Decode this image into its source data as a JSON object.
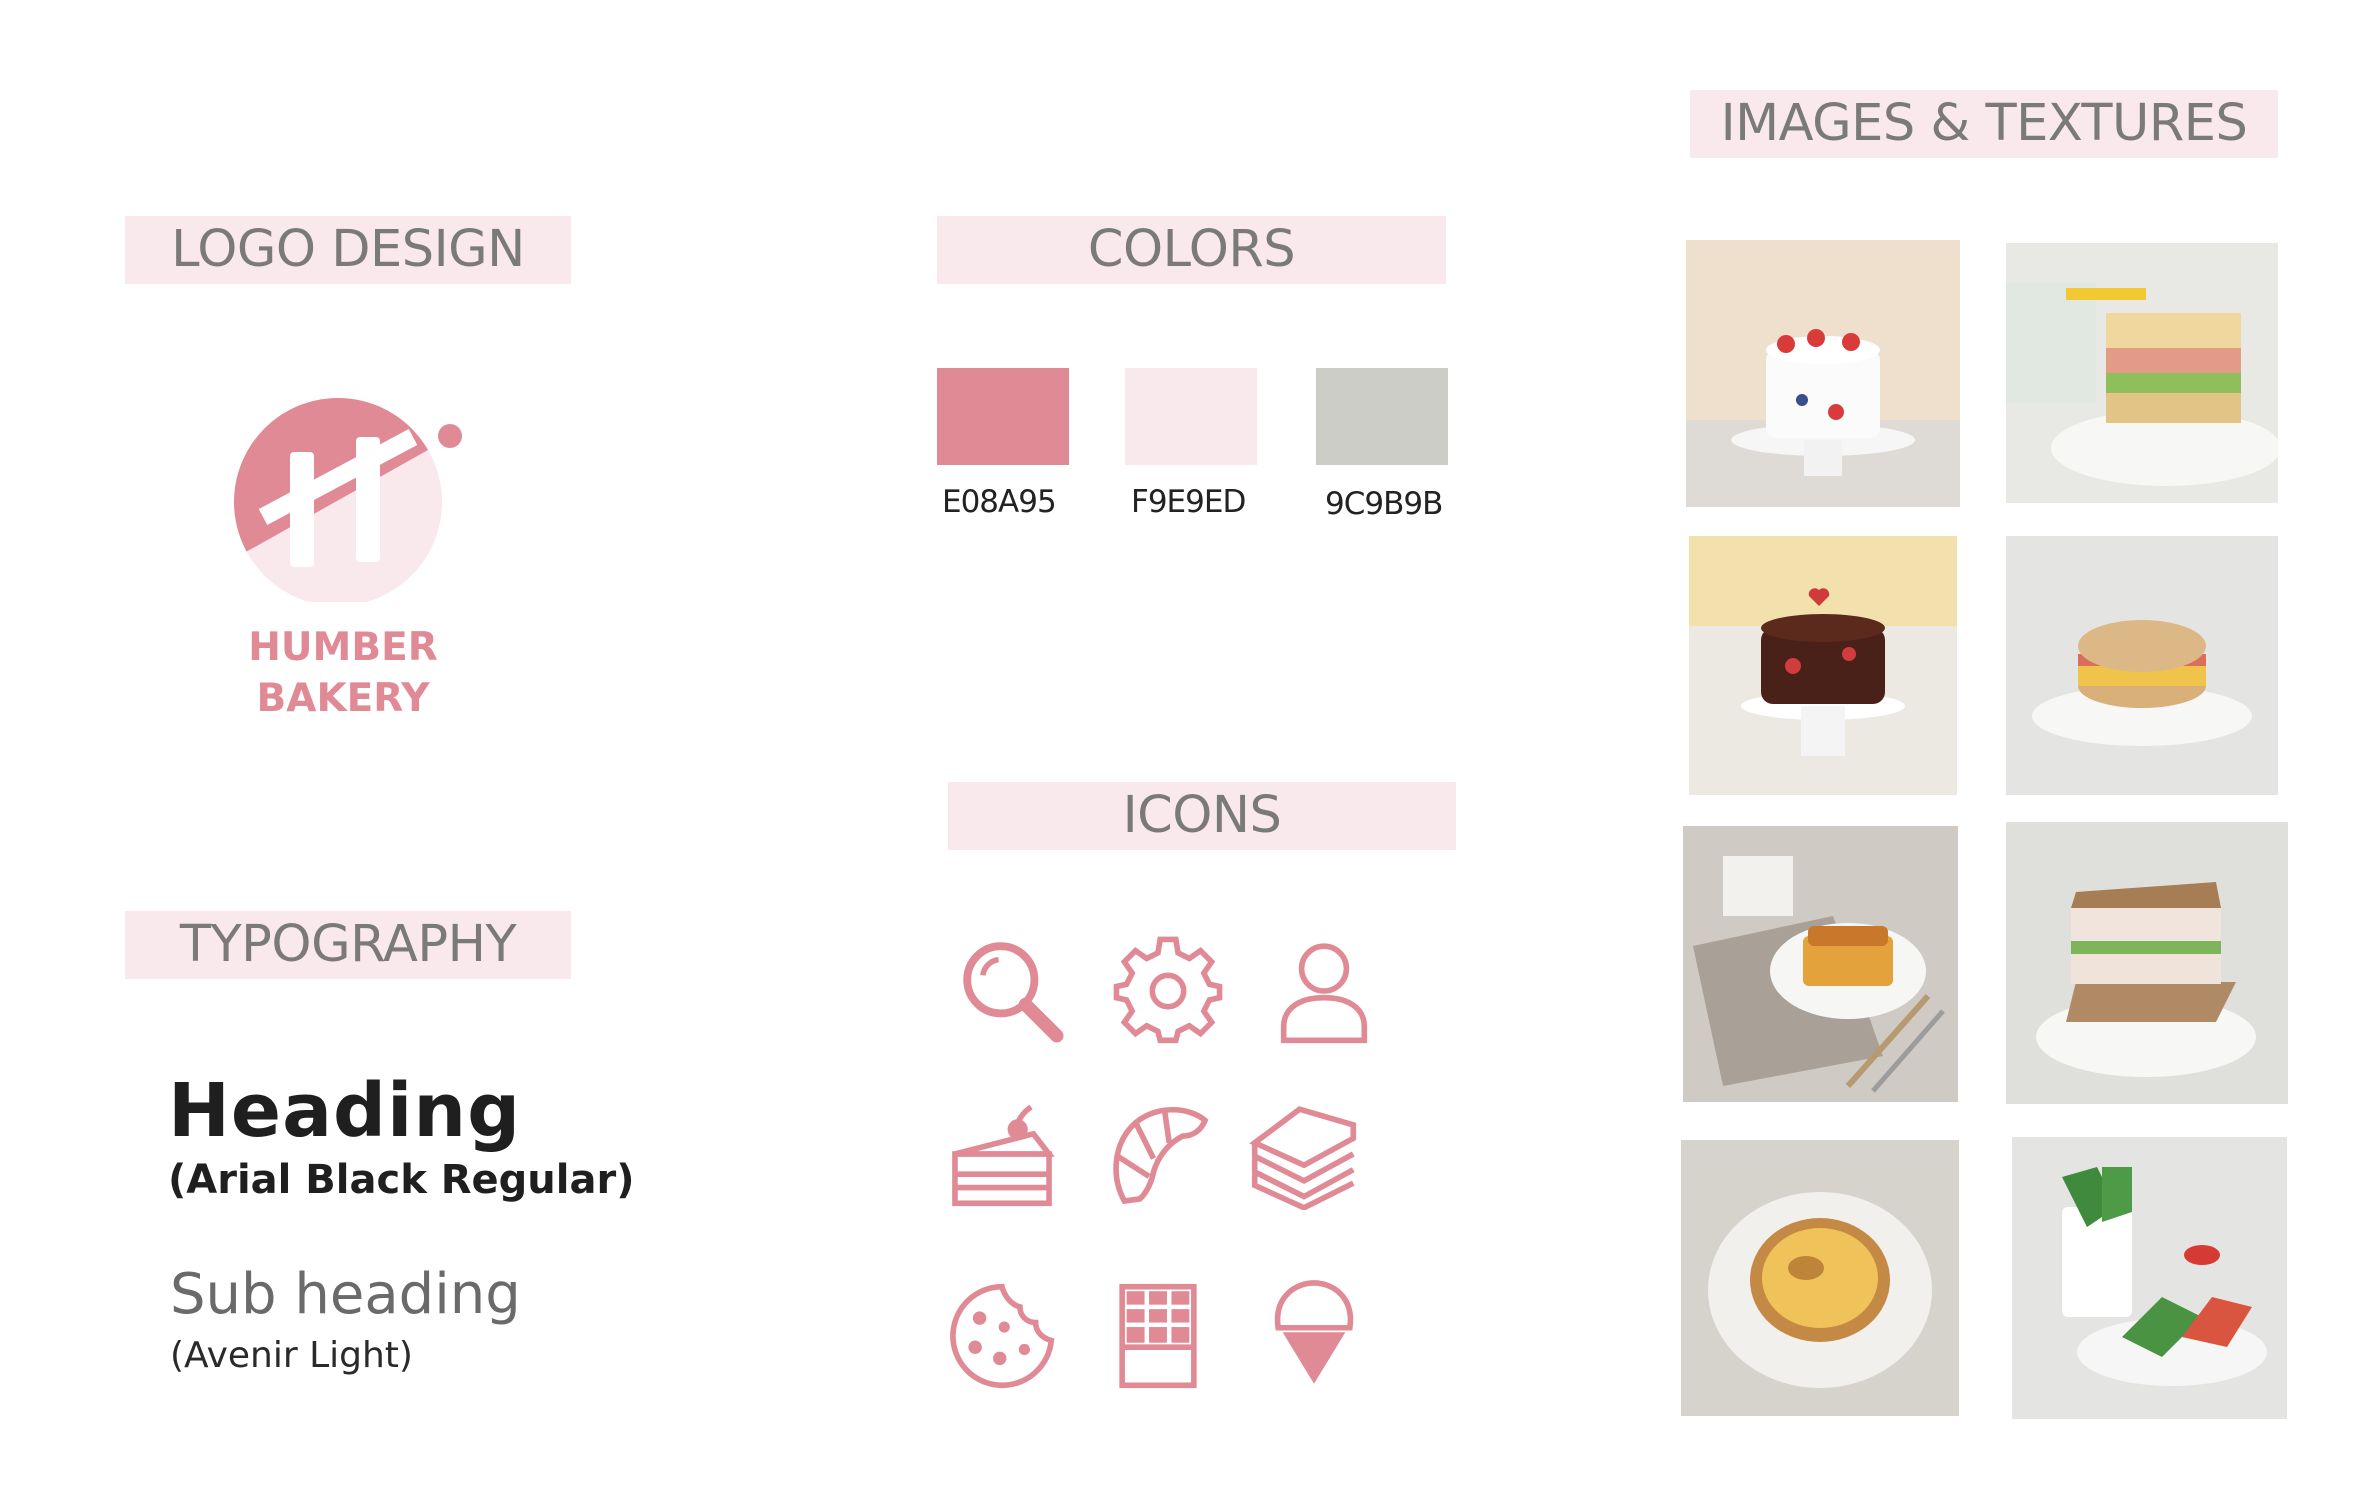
{
  "sections": {
    "logo": "LOGO DESIGN",
    "colors": "COLORS",
    "icons": "ICONS",
    "typography": "TYPOGRAPHY",
    "images": "IMAGES & TEXTURES"
  },
  "logo": {
    "line1": "HUMBER",
    "line2": "BAKERY"
  },
  "palette": [
    {
      "hex": "#E08A95",
      "label": "E08A95"
    },
    {
      "hex": "#F9E9ED",
      "label": "F9E9ED"
    },
    {
      "hex": "#C9C9C4",
      "label": "9C9B9B"
    }
  ],
  "typography": {
    "heading": "Heading",
    "heading_font": "(Arial Black Regular)",
    "subheading": "Sub heading",
    "subheading_font": "(Avenir Light)"
  },
  "icons": [
    "search-icon",
    "gear-icon",
    "user-icon",
    "cake-slice-icon",
    "croissant-icon",
    "sandwich-icon",
    "cookie-icon",
    "chocolate-bar-icon",
    "ice-cream-icon"
  ],
  "accent": "#E08A95",
  "banner_color": "#F9E9ED"
}
